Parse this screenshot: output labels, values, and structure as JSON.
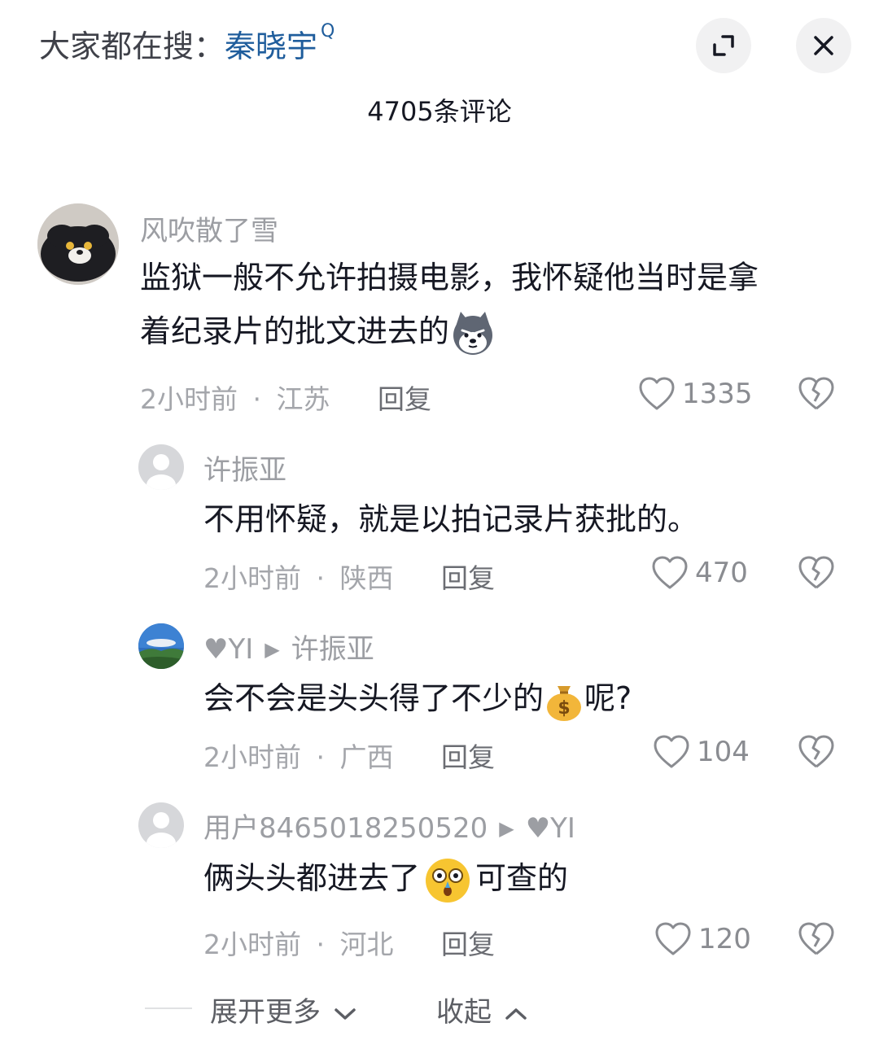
{
  "header": {
    "search_prefix": "大家都在搜：",
    "search_term": "秦晓宇",
    "search_icon_glyph": "Q",
    "comment_count_title": "4705条评论"
  },
  "comments": [
    {
      "username": "风吹散了雪",
      "text_line1": "监狱一般不允许拍摄电影，我怀疑他当时是拿",
      "text_line2": "着纪录片的批文进去的",
      "time": "2小时前",
      "sep": "·",
      "location": "江苏",
      "reply_label": "回复",
      "likes": "1335"
    },
    {
      "username": "许振亚",
      "text": "不用怀疑，就是以拍记录片获批的。",
      "time": "2小时前",
      "sep": "·",
      "location": "陕西",
      "reply_label": "回复",
      "likes": "470"
    },
    {
      "username": "♥YI",
      "reply_to": "许振亚",
      "text_before": "会不会是头头得了不少的",
      "text_after": "呢?",
      "time": "2小时前",
      "sep": "·",
      "location": "广西",
      "reply_label": "回复",
      "likes": "104"
    },
    {
      "username": "用户8465018250520",
      "reply_to": "♥YI",
      "text_before": "俩头头都进去了",
      "text_after": "可查的",
      "time": "2小时前",
      "sep": "·",
      "location": "河北",
      "reply_label": "回复",
      "likes": "120"
    }
  ],
  "footer": {
    "expand_more": "展开更多",
    "collapse": "收起"
  },
  "colors": {
    "search_term": "#1f5d9c",
    "meta_text": "#a4a6ab",
    "body_text": "#161823"
  }
}
